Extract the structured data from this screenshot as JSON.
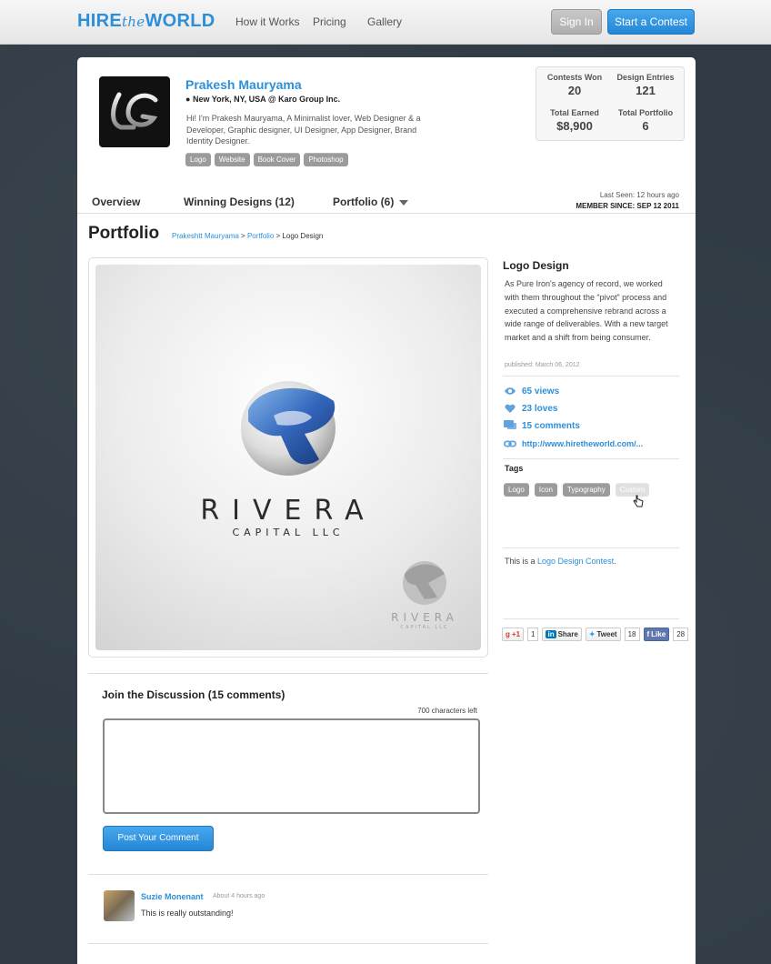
{
  "nav": {
    "brand_left": "HIRE",
    "brand_mid": "the",
    "brand_right": "WORLD",
    "links": [
      "How it Works",
      "Pricing",
      "Gallery"
    ],
    "sign_in": "Sign In",
    "start_contest": "Start a Contest"
  },
  "profile": {
    "avatar_text": "LG",
    "name": "Prakesh Mauryama",
    "location": "New York, NY, USA",
    "company": "@ Karo Group Inc.",
    "bio": "Hi! I'm Prakesh Mauryama, A Minimalist lover, Web Designer & a Developer, Graphic designer, UI Designer, App Designer, Brand Identity Designer.",
    "skills": [
      "Logo",
      "Website",
      "Book Cover",
      "Photoshop"
    ]
  },
  "stats": {
    "contests_won_label": "Contests Won",
    "contests_won": "20",
    "design_entries_label": "Design Entries",
    "design_entries": "121",
    "total_earned_label": "Total Earned",
    "total_earned": "$8,900",
    "total_portfolio_label": "Total Portfolio",
    "total_portfolio": "6"
  },
  "tabs": {
    "overview": "Overview",
    "winning": "Winning Designs (12)",
    "portfolio": "Portfolio (6)"
  },
  "last_seen": "Last Seen: 12 hours ago",
  "member_since": "MEMBER SINCE: SEP 12 2011",
  "portfolio": {
    "title": "Portfolio",
    "crumb_user": "Prakeshtt Mauryama",
    "crumb_sep1": " > ",
    "crumb_portfolio": "Portfolio",
    "crumb_sep2": " > Logo Design"
  },
  "artwork": {
    "brand": "RIVERA",
    "sub": "CAPITAL LLC"
  },
  "detail": {
    "title": "Logo Design",
    "description": "As Pure Iron's agency of record, we worked with them throughout the “pivot” process and executed a comprehensive rebrand across a wide range of deliverables. With a new target market and a shift from being consumer.",
    "published": "published: March 06, 2012",
    "views": "65 views",
    "loves": "23 loves",
    "comments": "15 comments",
    "url": "http://www.hiretheworld.com/...",
    "tags_title": "Tags",
    "tags": [
      "Logo",
      "Icon",
      "Typography",
      "Custom"
    ],
    "contest_prefix": "This is a ",
    "contest_link": "Logo Design Contest",
    "contest_suffix": "."
  },
  "social": {
    "gplus": "+1",
    "gplus_count": "1",
    "share": "Share",
    "tweet": "Tweet",
    "tweet_count": "18",
    "like": "Like",
    "like_count": "28"
  },
  "discussion": {
    "title": "Join the Discussion (15 comments)",
    "chars_left": "700 characters left",
    "post_button": "Post Your Comment"
  },
  "comment": {
    "name": "Suzie Monenant",
    "time": "About 4 hours ago",
    "text": "This is really outstanding!"
  },
  "colors": {
    "accent": "#2d8fd8",
    "tag_gray": "#9b9b9b"
  }
}
